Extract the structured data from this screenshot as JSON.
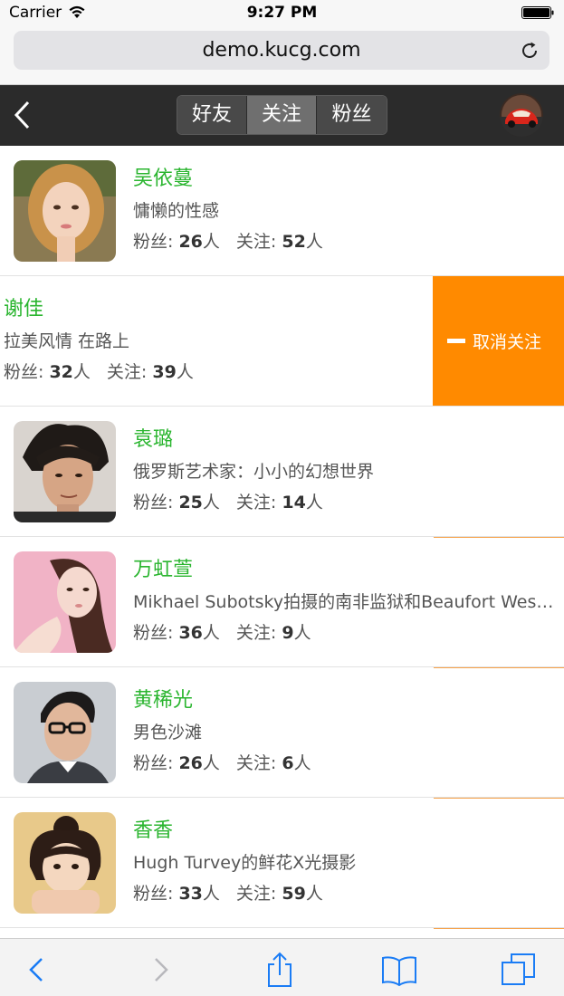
{
  "status": {
    "carrier": "Carrier",
    "time": "9:27 PM"
  },
  "browser": {
    "url": "demo.kucg.com"
  },
  "header": {
    "tabs": [
      "好友",
      "关注",
      "粉丝"
    ],
    "active_tab": 1
  },
  "labels": {
    "fans": "粉丝: ",
    "follow": "关注: ",
    "unit": "人",
    "unfollow": "取消关注"
  },
  "users": [
    {
      "name": "吴依蔓",
      "desc": "慵懒的性感",
      "fans": "26",
      "follow": "52"
    },
    {
      "name": "谢佳",
      "desc": "拉美风情 在路上",
      "fans": "32",
      "follow": "39"
    },
    {
      "name": "袁璐",
      "desc": "俄罗斯艺术家：小小的幻想世界",
      "fans": "25",
      "follow": "14"
    },
    {
      "name": "万虹萱",
      "desc": "Mikhael Subotsky拍摄的南非监狱和Beaufort West...",
      "fans": "36",
      "follow": "9"
    },
    {
      "name": "黄稀光",
      "desc": "男色沙滩",
      "fans": "26",
      "follow": "6"
    },
    {
      "name": "香香",
      "desc": "Hugh Turvey的鲜花X光摄影",
      "fans": "33",
      "follow": "59"
    }
  ],
  "colors": {
    "name_green": "#2ab52f",
    "unfollow_orange": "#ff8a00",
    "header_dark": "#2b2b2b",
    "ios_blue": "#1a7cf5"
  },
  "icons": [
    "wifi-icon",
    "battery-icon",
    "reload-icon",
    "back-icon",
    "chevron-left-icon",
    "chevron-right-icon",
    "share-icon",
    "bookmarks-icon",
    "tabs-icon",
    "minus-icon"
  ]
}
